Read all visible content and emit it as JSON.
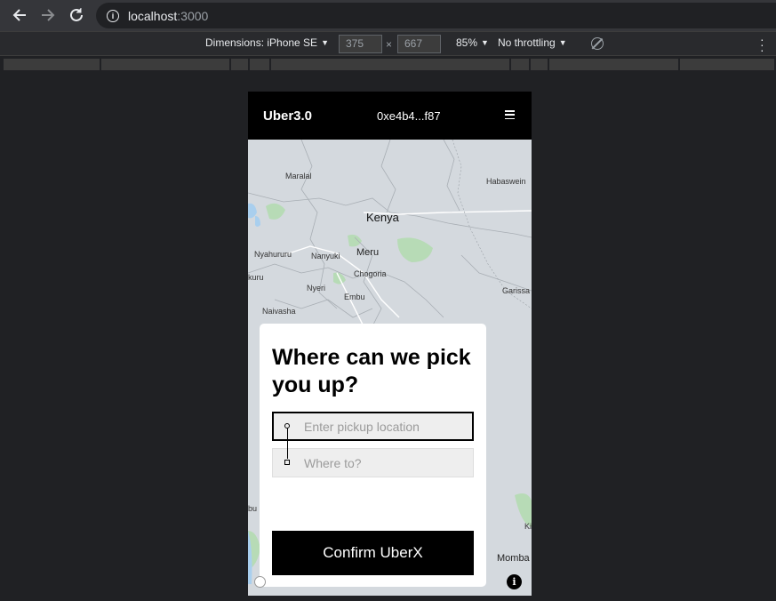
{
  "browser": {
    "url_host": "localhost",
    "url_port": ":3000"
  },
  "device_toolbar": {
    "dimensions_label": "Dimensions: iPhone SE",
    "width": "375",
    "height": "667",
    "times": "×",
    "zoom": "85%",
    "throttling": "No throttling"
  },
  "app": {
    "logo": "Uber3.0",
    "wallet": "0xe4b4...f87"
  },
  "map": {
    "labels": {
      "maralal": "Maralal",
      "habaswein": "Habaswein",
      "kenya": "Kenya",
      "nyahururu": "Nyahururu",
      "nanyuki": "Nanyuki",
      "meru": "Meru",
      "chogoria": "Chogoria",
      "kuru": "kuru",
      "nyeri": "Nyeri",
      "garissa": "Garissa",
      "embu": "Embu",
      "naivasha": "Naivasha",
      "bu": "bu",
      "ki": "Ki",
      "momba": "Momba"
    }
  },
  "card": {
    "title": "Where can we pick you up?",
    "pickup_placeholder": "Enter pickup location",
    "dest_placeholder": "Where to?",
    "confirm_label": "Confirm UberX"
  },
  "colors": {
    "header_bg": "#000000",
    "map_bg": "#d4d9de",
    "park_green": "#b7dbb6",
    "water_blue": "#a9cfee"
  }
}
